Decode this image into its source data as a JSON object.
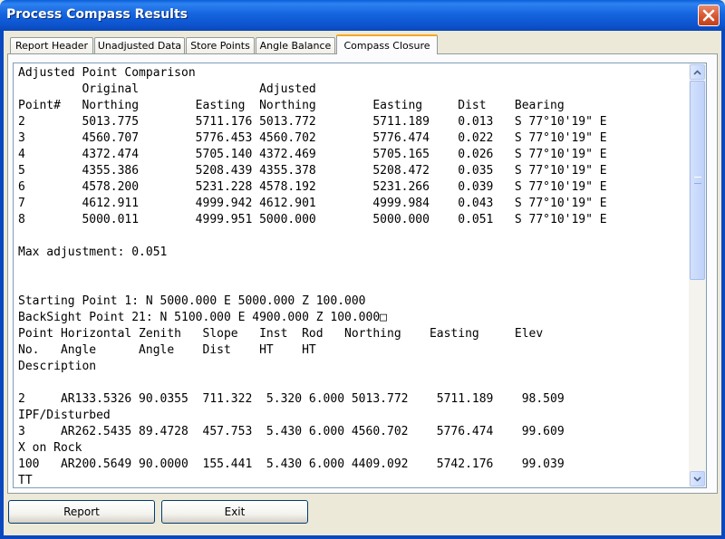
{
  "window": {
    "title": "Process Compass Results"
  },
  "tabs": [
    {
      "label": "Report Header",
      "active": false
    },
    {
      "label": "Unadjusted Data",
      "active": false
    },
    {
      "label": "Store Points",
      "active": false
    },
    {
      "label": "Angle Balance",
      "active": false
    },
    {
      "label": "Compass Closure",
      "active": true
    }
  ],
  "report": {
    "lines": [
      "Adjusted Point Comparison",
      "         Original                 Adjusted",
      "Point#   Northing        Easting  Northing        Easting     Dist    Bearing",
      "2        5013.775        5711.176 5013.772        5711.189    0.013   S 77°10'19\" E",
      "3        4560.707        5776.453 4560.702        5776.474    0.022   S 77°10'19\" E",
      "4        4372.474        5705.140 4372.469        5705.165    0.026   S 77°10'19\" E",
      "5        4355.386        5208.439 4355.378        5208.472    0.035   S 77°10'19\" E",
      "6        4578.200        5231.228 4578.192        5231.266    0.039   S 77°10'19\" E",
      "7        4612.911        4999.942 4612.901        4999.984    0.043   S 77°10'19\" E",
      "8        5000.011        4999.951 5000.000        5000.000    0.051   S 77°10'19\" E",
      "",
      "Max adjustment: 0.051",
      "",
      "",
      "Starting Point 1: N 5000.000 E 5000.000 Z 100.000",
      "BackSight Point 21: N 5100.000 E 4900.000 Z 100.000□",
      "Point Horizontal Zenith   Slope   Inst  Rod   Northing    Easting     Elev",
      "No.   Angle      Angle    Dist    HT    HT",
      "Description",
      "",
      "2     AR133.5326 90.0355  711.322  5.320 6.000 5013.772    5711.189    98.509",
      "IPF/Disturbed",
      "3     AR262.5435 89.4728  457.753  5.430 6.000 4560.702    5776.474    99.609",
      "X on Rock",
      "100   AR200.5649 90.0000  155.441  5.430 6.000 4409.092    5742.176    99.039",
      "TT"
    ]
  },
  "buttons": {
    "report": "Report",
    "exit": "Exit"
  },
  "icons": {
    "close": "close-icon",
    "scroll_up": "chevron-up-icon",
    "scroll_down": "chevron-down-icon"
  }
}
